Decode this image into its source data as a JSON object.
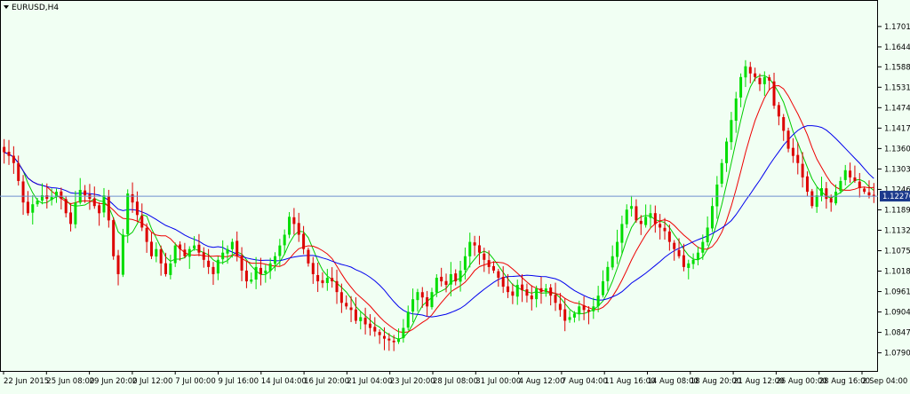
{
  "window": {
    "title": "EURUSD,H4",
    "menu_icon": "triangle-down-icon"
  },
  "colors": {
    "background": "#f1fff3",
    "bull": "#00dd00",
    "bear": "#dd0000",
    "ma_fast": "#00cc00",
    "ma_mid": "#ee0000",
    "ma_slow": "#0000ee",
    "price_line": "#6f8fcf",
    "current_price_bg": "#1b3a8c"
  },
  "chart_data": {
    "type": "candlestick",
    "symbol": "EURUSD",
    "timeframe": "H4",
    "ylim": [
      1.074,
      1.177
    ],
    "y_ticks": [
      "1.17010",
      "1.16440",
      "1.15885",
      "1.15315",
      "1.14745",
      "1.14175",
      "1.13605",
      "1.13035",
      "1.12465",
      "1.11895",
      "1.11325",
      "1.10755",
      "1.10185",
      "1.09615",
      "1.09045",
      "1.08475",
      "1.07905"
    ],
    "x_ticks": [
      "22 Jun 2015",
      "25 Jun 08:00",
      "29 Jun 20:00",
      "2 Jul 12:00",
      "7 Jul 00:00",
      "9 Jul 16:00",
      "14 Jul 04:00",
      "16 Jul 20:00",
      "21 Jul 04:00",
      "23 Jul 20:00",
      "28 Jul 08:00",
      "31 Jul 00:00",
      "4 Aug 12:00",
      "7 Aug 04:00",
      "11 Aug 16:00",
      "14 Aug 08:00",
      "18 Aug 20:00",
      "21 Aug 12:00",
      "26 Aug 00:00",
      "28 Aug 16:00",
      "2 Sep 04:00"
    ],
    "current_price": 1.12276,
    "current_price_label": "1.12276",
    "candle_count": 198,
    "closes": [
      1.135,
      1.134,
      1.132,
      1.127,
      1.121,
      1.118,
      1.1205,
      1.1215,
      1.123,
      1.122,
      1.1225,
      1.124,
      1.122,
      1.118,
      1.115,
      1.121,
      1.1245,
      1.123,
      1.122,
      1.12,
      1.118,
      1.123,
      1.116,
      1.106,
      1.101,
      1.112,
      1.1235,
      1.121,
      1.1175,
      1.114,
      1.11,
      1.106,
      1.108,
      1.104,
      1.101,
      1.104,
      1.109,
      1.108,
      1.106,
      1.108,
      1.109,
      1.107,
      1.105,
      1.103,
      1.101,
      1.105,
      1.107,
      1.108,
      1.11,
      1.106,
      1.102,
      1.099,
      1.0995,
      1.103,
      1.101,
      1.102,
      1.104,
      1.106,
      1.109,
      1.112,
      1.117,
      1.115,
      1.112,
      1.108,
      1.104,
      1.101,
      1.099,
      1.0985,
      1.1,
      1.099,
      1.096,
      1.093,
      1.092,
      1.091,
      1.088,
      1.089,
      1.087,
      1.086,
      1.085,
      1.084,
      1.083,
      1.0825,
      1.082,
      1.083,
      1.086,
      1.0905,
      1.094,
      1.096,
      1.0945,
      1.092,
      1.096,
      1.1,
      1.099,
      1.098,
      1.101,
      1.099,
      1.102,
      1.106,
      1.11,
      1.109,
      1.107,
      1.105,
      1.103,
      1.102,
      1.1,
      1.0975,
      1.096,
      1.095,
      1.098,
      1.0965,
      1.095,
      1.094,
      1.097,
      1.096,
      1.097,
      1.095,
      1.093,
      1.091,
      1.088,
      1.089,
      1.09,
      1.092,
      1.091,
      1.0905,
      1.092,
      1.095,
      1.099,
      1.103,
      1.106,
      1.11,
      1.115,
      1.119,
      1.12,
      1.116,
      1.115,
      1.117,
      1.118,
      1.115,
      1.114,
      1.113,
      1.11,
      1.108,
      1.106,
      1.103,
      1.104,
      1.105,
      1.107,
      1.11,
      1.114,
      1.12,
      1.126,
      1.132,
      1.138,
      1.144,
      1.15,
      1.156,
      1.159,
      1.157,
      1.156,
      1.154,
      1.156,
      1.155,
      1.148,
      1.145,
      1.141,
      1.136,
      1.134,
      1.132,
      1.128,
      1.124,
      1.12,
      1.123,
      1.125,
      1.122,
      1.121,
      1.124,
      1.127,
      1.13,
      1.128,
      1.127,
      1.125,
      1.124,
      1.123,
      1.1228
    ],
    "moving_averages": [
      {
        "period": 5,
        "color_key": "ma_fast"
      },
      {
        "period": 10,
        "color_key": "ma_mid"
      },
      {
        "period": 21,
        "color_key": "ma_slow"
      }
    ]
  }
}
